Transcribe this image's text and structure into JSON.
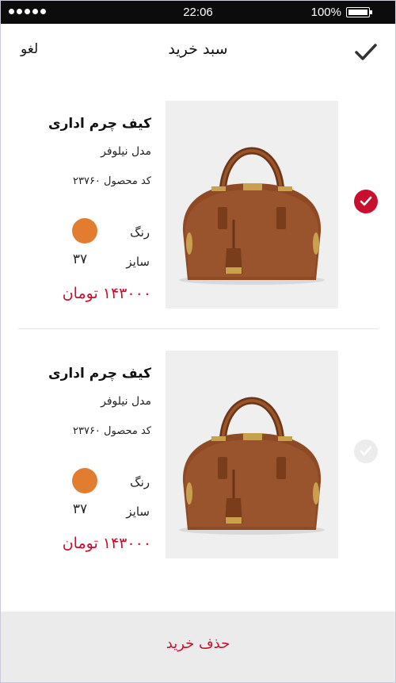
{
  "status_bar": {
    "time": "22:06",
    "battery": "100%"
  },
  "header": {
    "title": "سبد خرید",
    "cancel_label": "لغو",
    "confirm_icon": "checkmark-icon"
  },
  "items": [
    {
      "name": "کیف چرم اداری",
      "model": "مدل نیلوفر",
      "code": "کد محصول ۲۳۷۶۰",
      "color_label": "رنگ",
      "color": "#e27c2e",
      "size_label": "سایز",
      "size": "۳۷",
      "price": "۱۴۳۰۰۰ تومان",
      "selected": true
    },
    {
      "name": "کیف چرم اداری",
      "model": "مدل نیلوفر",
      "code": "کد محصول ۲۳۷۶۰",
      "color_label": "رنگ",
      "color": "#e27c2e",
      "size_label": "سایز",
      "size": "۳۷",
      "price": "۱۴۳۰۰۰ تومان",
      "selected": false
    }
  ],
  "footer": {
    "delete_label": "حذف خرید"
  },
  "colors": {
    "accent": "#c8102e",
    "swatch": "#e27c2e"
  }
}
